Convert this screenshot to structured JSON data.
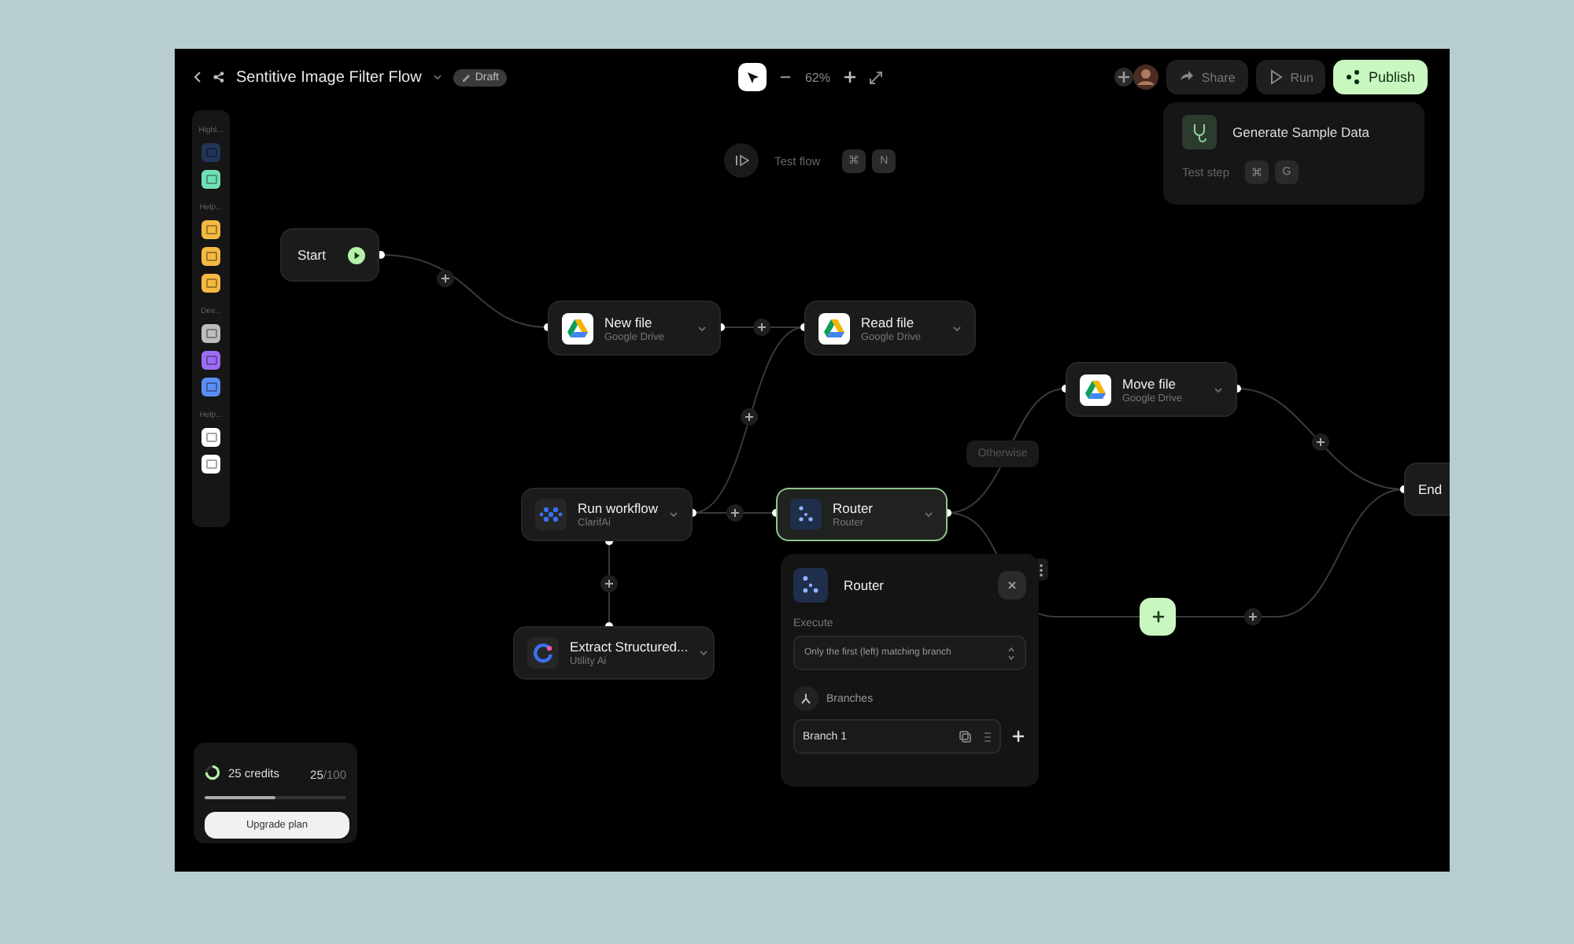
{
  "window": {
    "title": "Sentitive Image Filter Flow",
    "badge": "Draft"
  },
  "zoom": {
    "value": "62%"
  },
  "header_actions": [
    {
      "label": "Share",
      "kind": "secondary"
    },
    {
      "label": "Run",
      "kind": "secondary"
    },
    {
      "label": "Publish",
      "kind": "primary"
    }
  ],
  "dropdown": {
    "title": "Generate Sample Data",
    "hint": "Test step",
    "keys": [
      "⌘",
      "G"
    ]
  },
  "test_flow": {
    "label": "Test flow",
    "keys": [
      "⌘",
      "N"
    ]
  },
  "sidebar": {
    "sections": [
      {
        "label": "Highl...",
        "items": [
          {
            "color": "#22355a"
          },
          {
            "color": "#6fe0b4"
          }
        ]
      },
      {
        "label": "Help...",
        "items": [
          {
            "color": "#f5b942"
          },
          {
            "color": "#f5b942"
          },
          {
            "color": "#f5b942"
          }
        ]
      },
      {
        "label": "Dev...",
        "items": [
          {
            "color": "#bdbdbd"
          },
          {
            "color": "#9d6cf5"
          },
          {
            "color": "#5b8df5"
          }
        ]
      },
      {
        "label": "Help...",
        "items": [
          {
            "color": "#ffffff"
          },
          {
            "color": "#ffffff"
          }
        ]
      }
    ]
  },
  "nodes": [
    {
      "kind": "start",
      "title": "Start",
      "selected": false
    },
    {
      "kind": "gdrive",
      "title": "New file",
      "subtitle": "Google Drive",
      "selected": false
    },
    {
      "kind": "gdrive",
      "title": "Read file",
      "subtitle": "Google Drive",
      "selected": false
    },
    {
      "kind": "workflow",
      "title": "Run workflow",
      "subtitle": "ClarifAi",
      "selected": false
    },
    {
      "kind": "router",
      "title": "Router",
      "subtitle": "Router",
      "selected": true
    },
    {
      "kind": "extract",
      "title": "Extract Structured...",
      "subtitle": "Utility Ai",
      "selected": false
    },
    {
      "kind": "gdrive",
      "title": "Move file",
      "subtitle": "Google Drive",
      "selected": false
    },
    {
      "kind": "end",
      "title": "End",
      "selected": false
    }
  ],
  "edge_labels": [
    "Otherwise"
  ],
  "router_panel": {
    "title": "Router",
    "execute_label": "Execute",
    "execute_value": "Only the first (left) matching branch",
    "branches_label": "Branches",
    "branches": [
      {
        "name": "Branch 1"
      }
    ]
  },
  "credits": {
    "label": "25 credits",
    "used": "25",
    "total": "/100",
    "level": 0.5,
    "button": "Upgrade plan"
  }
}
